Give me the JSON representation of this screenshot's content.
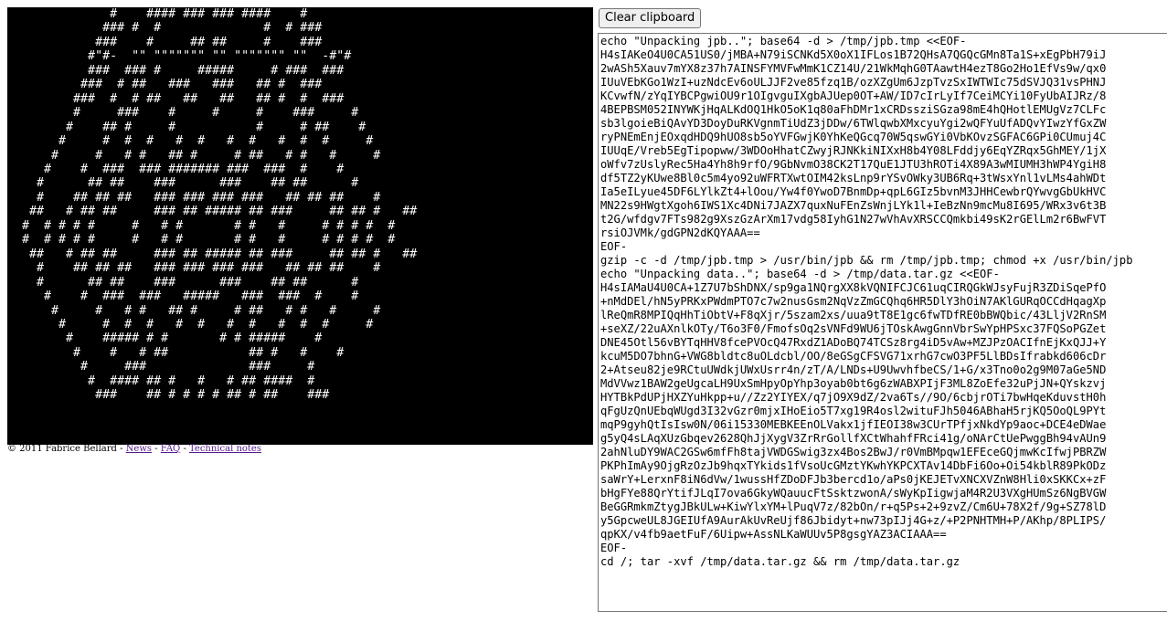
{
  "terminal": {
    "screen": "              #    #### ### ### ####    #\n             ### #  #              #  # ###\n            ###    #     ## ##     #    ###\n           #\"#-  \"\" \"\"\"\"\"\"\" \"\" \"\"\"\"\"\"\" \"\"  -#\"#\n           ###  ### #     #####     # ###  ###\n          ###  # ##   ###   ###   ## #  ###\n         ###  #  # ##   ##   ##   ## #  #  ###\n         #     ###    #     #     #    ###     #\n        #    ## #     #           #     # ##    #\n       #     #  #  #   #  #   #  #   #  #  #     #\n      #     #   # #   ## #     # ##   # #   #     #\n     #    #  ###  ### ####### ###  ###  #    #\n    #      ## ##    ###      ###    ## ##      #\n    #    ## ## ##   ### ### ### ###   ## ## ##    #\n   ##   # ## ##     ### ## ##### ## ###     ## ## #   ##\n  #  # # # #     #   # #       # #   #     # # # #  #\n  #  # # # #     #   # #       # #   #     # # # #  #\n   ##   # ## ##     ### ## ##### ## ###     ## ## #   ##\n    #    ## ## ##   ### ### ### ###   ## ## ##    #\n    #      ## ##    ###      ###    ## ##      #\n     #    #  ###  ###   #####   ###  ###  #    #\n      #     #   # #   ## #     # ##   # #   #     #\n       #     #  #  #   #  #   #  #   #  #  #     #\n        #    ##### # #       # # #####    #\n         #    #   # ##           ## #   #    #\n          #     ###              ###     #\n           #  #### ## #   #   # ## ####  #\n            ###    ## # # # # ## # ##    ###",
    "bg_color": "#000000",
    "fg_color": "#ffffff"
  },
  "footer": {
    "copyright": "© 2011 Fabrice Bellard - ",
    "sep1": " - ",
    "sep2": " - ",
    "links": [
      "News",
      "FAQ",
      "Technical notes"
    ],
    "link_color": "#551a8b"
  },
  "clipboard": {
    "button_label": "Clear clipboard",
    "content": "echo \"Unpacking jpb..\"; base64 -d > /tmp/jpb.tmp <<EOF-\nH4sIAKeO4U0CA51US0/jMBA+N79iSCNKd5X0oX1IFLos1B72QHsA7QGQcGMn8Ta1S+xEgPbH79iJ\n2wASh5Xauv7mYX8z37h7AINSFYMVFwMmK1CZ14U/21WkMqhG0TAawtH4ezT8Go2Ho1EfVs9w/qx0\nIUuVEbKGo1WzI+uzNdcEv6oULJJF2ve85fzq1B/ozXZgUm6JzpTvzSxIWTWIc75dSVJQ31vsPHNJ\nKCvwfN/zYqIYBCPgwiOU9r1OIgvguIXgbAJUep0OT+AW/ID7cIrLyIf7CeiMCYi10FyUbAIJRz/8\n4BEPBSM052INYWKjHqALKdOQ1HkO5oK1q80aFhDMr1xCRDssziSGza98mE4hQHotlEMUgVz7CLFc\nsb3lgoieBiQAvYD3DoyDuRKVgnmTiUdZ3jDDw/6TWlqwbXMxcyuYgi2wQFYuUfADQvYIwzYfGxZW\nryPNEmEnjEOxqdHDQ9hUO8sb5oYVFGwjK0YhKeQGcq70W5qswGYi0VbKOvzSGFAC6GPi0CUmuj4C\nIUUqE/Vreb5EgTipopww/3WDOoHhatCZwyjRJNKkiNIXxH8b4Y08LFddjy6EqYZRqx5GhMEY/1jX\noWfv7zUslyRec5Ha4Yh8h9rfO/9GbNvmO38CK2T17QuE1JTU3hROTi4X89A3wMIUMH3hWP4YgiH8\ndf5TZ2yKUwe8Bl0c5m4yo92uWFRTXwtOIM42ksLnp9rYSvOWky3UB6Rq+3tWsxYnl1vLMs4ahWDt\nIa5eILyue45DF6LYlkZt4+lOou/Yw4f0YwoD7BnmDp+qpL6GIz5bvnM3JHHCewbrQYwvgGbUkHVC\nMN22s9HWgtXgoh6IWS1Xc4DNi7JAZX7quxNuFEnZsWnjLYk1l+IeBzNn9mcMu8I695/WRx3v6t3B\nt2G/wfdgv7FTs982g9XszGzArXm17vdg58IyhG1N27wVhAvXRSCCQmkbi49sK2rGElLm2r6BwFVT\nrsiOJVMk/gdGPN2dKQYAAA==\nEOF-\ngzip -c -d /tmp/jpb.tmp > /usr/bin/jpb && rm /tmp/jpb.tmp; chmod +x /usr/bin/jpb\necho \"Unpacking data..\"; base64 -d > /tmp/data.tar.gz <<EOF-\nH4sIAMaU4U0CA+1Z7U7bShDNX/sp9ga1NQrgXX8kVQNIFCJC61uqCIRQGkWJsyFujR3ZDiSqePfO\n+nMdDEl/hN5yPRKxPWdmPTO7c7w2nusGsm2NqVzZmGCQhq6HR5DlY3hOiN7AKlGURqOCCdHqagXp\nlReQmR8MPIQqHhTiObtV+F8qXjr/5szam2xs/uua9tT8E1gc6fwTDfRE0bBWQbic/43LljV2RnSM\n+seXZ/22uAXnlkOTy/T6o3F0/FmofsOq2sVNFd9WU6jTOskAwgGnnVbrSwYpHPSxc37FQSoPGZet\nDNE45Otl56vBYTqHHV8fcePVOcQ47RxdZ1ADoBQ74TCSz8rg4iD5vAw+MZJPzOACIfnEjKxQJJ+Y\nkcuM5DO7bhnG+VWG8bldtc8uOLdcbl/OO/8eGSgCFSVG71xrhG7cwO3PF5LlBDsIfrabkd606cDr\n2+Atseu82je9RCtuUWdkjUWxUsrr4n/zT/A/LNDs+U9UwvhfbeCS/1+G/x3Tno0o2g9M07aGe5ND\nMdVVwz1BAW2geUgcaLH9UxSmHpyOpYhp3oyab0bt6g6zWABXPIjF3ML8ZoEfe32uPjJN+QYskzvj\nHYTBkPdUPjHXZYuHkpp+u//Zz2YIYEX/q7jO9X9dZ/2va6Ts//9O/6cbjrOTi7bwHqeKduvstH0h\nqFgUzQnUEbqWUgd3I32vGzr0mjxIHoEio5T7xg19R4osl2wituFJh5046ABhaH5rjKQ5OoQL9PYt\nmqP9gyhQtIsIsw0N/06i15330MEBKEEnOLVakx1jfIEOI38w3CUrTPfjxNkdYp9aoc+DCE4eDWae\ng5yQ4sLAqXUzGbqev2628QhJjXygV3ZrRrGollfXCtWhahfFRci41g/oNArCtUePwggBh94vAUn9\n2ahNluDY9WAC2GSw6mfFh8tajVWDGSwig3zx4Bos2BwJ/r0VmBMpqw1EFEceGQjmwKcIfwjPBRZW\nPKPhImAy9OjgRzOzJb9hqxTYkids1fVsoUcGMztYKwhYKPCXTAv14DbFi6Oo+Oi54kblR89PkODz\nsaWrY+LerxnF8iN6dVw/1wussHfZDoDFJb3bercd1o/aPs0jKEJETvXNCXVZnW8Hli0xSKKCx+zF\nbHgFYe88QrYtifJLqI7ova6GkyWQauucFtSsktzwonA/sWyKpIigwjaM4R2U3VXgHUmSz6NgBVGW\nBeGGRmkmZtygJBkULw+KiwYlxYM+lPuqV7z/82bOn/r+q5Ps+2+9zvZ/Cm6U+78X2f/9g+SZ78lD\ny5GpcweUL8JGEIUfA9AurAkUvReUjf86Jbidyt+nw73pIJj4G+z/+P2PNHTMH+P/AKhp/8PLIPS/\nqpKX/v4fb9aetFuF/6Uipw+AssNLKaWUUv5P8gsgYAZ3ACIAAA==\nEOF-\ncd /; tar -xvf /tmp/data.tar.gz && rm /tmp/data.tar.gz"
  }
}
